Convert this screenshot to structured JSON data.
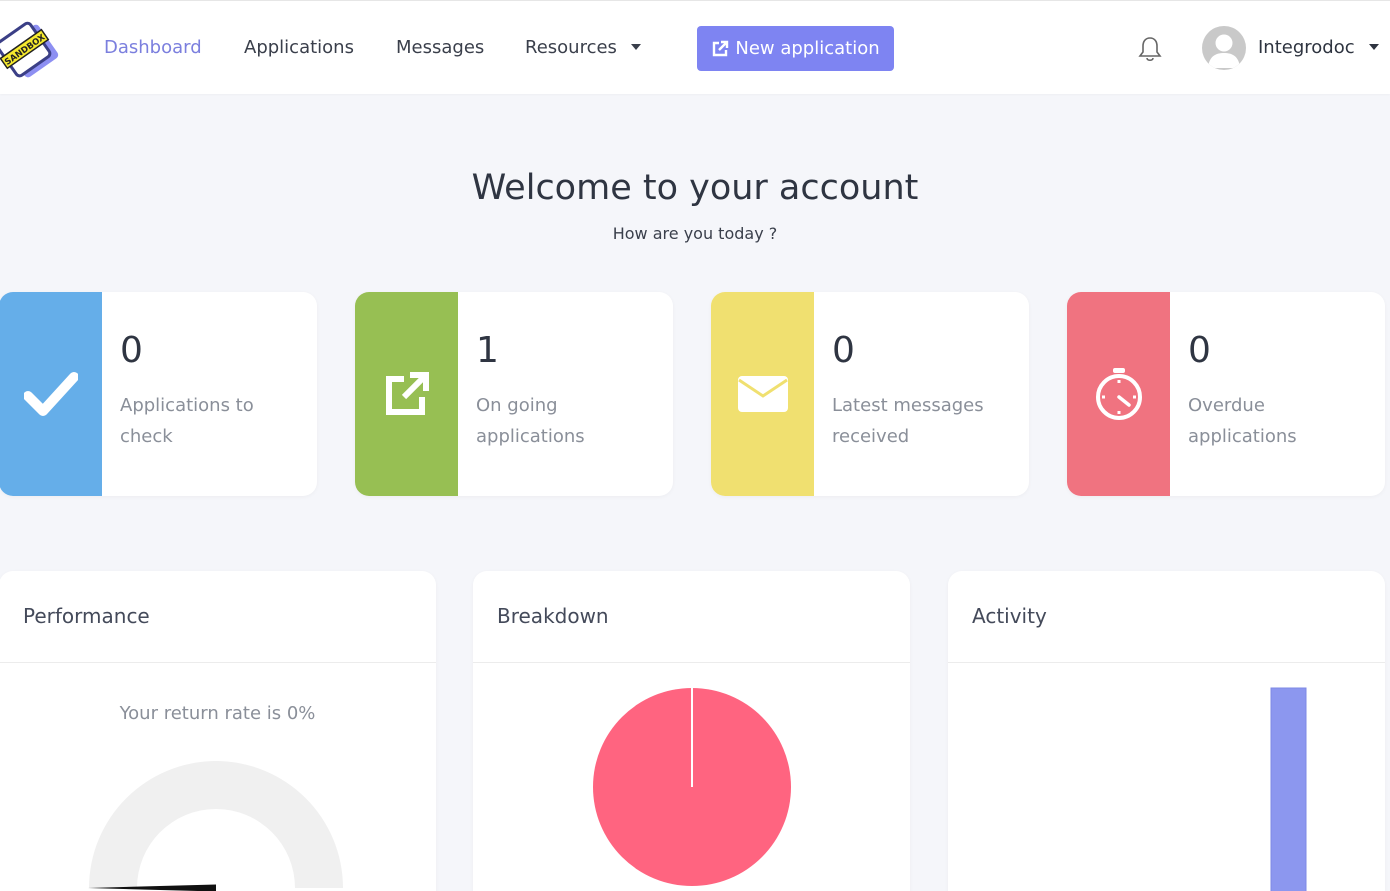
{
  "nav": {
    "logo_text": "SANDBOX",
    "links": [
      {
        "label": "Dashboard",
        "active": true
      },
      {
        "label": "Applications",
        "active": false
      },
      {
        "label": "Messages",
        "active": false
      },
      {
        "label": "Resources",
        "active": false
      }
    ],
    "new_application_label": "New application",
    "user_name": "Integrodoc"
  },
  "welcome": {
    "title": "Welcome to your account",
    "subtitle": "How are you today ?"
  },
  "stats": [
    {
      "value": "0",
      "label": "Applications to check",
      "icon": "check-icon",
      "color": "#65aee9"
    },
    {
      "value": "1",
      "label": "On going applications",
      "icon": "external-link-icon",
      "color": "#97bf53"
    },
    {
      "value": "0",
      "label": "Latest messages received",
      "icon": "envelope-icon",
      "color": "#f0e070"
    },
    {
      "value": "0",
      "label": "Overdue applications",
      "icon": "stopwatch-icon",
      "color": "#f07380"
    }
  ],
  "panels": {
    "performance": {
      "title": "Performance",
      "return_text": "Your return rate is 0%"
    },
    "breakdown": {
      "title": "Breakdown"
    },
    "activity": {
      "title": "Activity"
    }
  },
  "colors": {
    "accent": "#7e84f2",
    "active_link": "#7b7fde",
    "pie": "#ff6480",
    "activity_bar": "#8c97ef"
  },
  "chart_data": [
    {
      "type": "gauge",
      "value": 0,
      "max": 100
    },
    {
      "type": "pie",
      "values": [
        100
      ],
      "colors": [
        "#ff6480"
      ]
    },
    {
      "type": "bar",
      "values": [
        1
      ],
      "colors": [
        "#8c97ef"
      ]
    }
  ]
}
